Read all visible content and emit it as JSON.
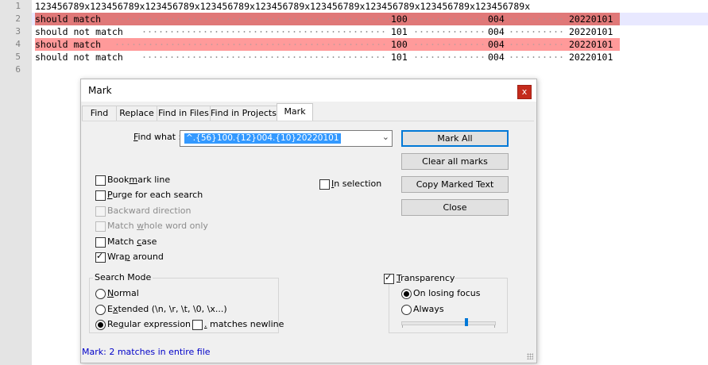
{
  "editor": {
    "lines": [
      {
        "number": "1",
        "text": "123456789x123456789x123456789x123456789x123456789x123456789x123456789x123456789x123456789x"
      },
      {
        "number": "2",
        "label": "should match",
        "col2": "100",
        "col3": "004",
        "col4": "20220101",
        "marked": true,
        "current": true
      },
      {
        "number": "3",
        "label": "should not match",
        "col2": "101",
        "col3": "004",
        "col4": "20220101",
        "marked": false
      },
      {
        "number": "4",
        "label": "should match",
        "col2": "100",
        "col3": "004",
        "col4": "20220101",
        "marked": true
      },
      {
        "number": "5",
        "label": "should not match",
        "col2": "101",
        "col3": "004",
        "col4": "20220101",
        "marked": false
      },
      {
        "number": "6",
        "text": ""
      }
    ],
    "mark_color": "#ff9a9a",
    "mark_color_current": "#e07878",
    "current_line_color": "#e8e8ff"
  },
  "dialog": {
    "title": "Mark",
    "close_glyph": "x",
    "tabs": [
      {
        "label": "Find"
      },
      {
        "label": "Replace"
      },
      {
        "label": "Find in Files"
      },
      {
        "label": "Find in Projects"
      },
      {
        "label": "Mark",
        "active": true
      }
    ],
    "find_label_pre": "",
    "find_label_ul": "F",
    "find_label_post": "ind what :",
    "find_value": "^.{56}100.{12}004.{10}20220101",
    "buttons": {
      "mark_all": "Mark All",
      "clear_all_marks": "Clear all marks",
      "copy_marked_text": "Copy Marked Text",
      "close": "Close"
    },
    "options": {
      "bookmark_line": {
        "pre": "Book",
        "ul": "m",
        "post": "ark line",
        "checked": false,
        "enabled": true
      },
      "purge_each_search": {
        "pre": "",
        "ul": "P",
        "post": "urge for each search",
        "checked": false,
        "enabled": true
      },
      "backward_direction": {
        "pre": "Backward direction",
        "ul": "",
        "post": "",
        "checked": false,
        "enabled": false
      },
      "match_whole_word": {
        "pre": "Match ",
        "ul": "w",
        "post": "hole word only",
        "checked": false,
        "enabled": false
      },
      "match_case": {
        "pre": "Match ",
        "ul": "c",
        "post": "ase",
        "checked": false,
        "enabled": true
      },
      "wrap_around": {
        "pre": "Wra",
        "ul": "p",
        "post": " around",
        "checked": true,
        "enabled": true
      },
      "in_selection": {
        "pre": "",
        "ul": "I",
        "post": "n selection",
        "checked": false,
        "enabled": true
      }
    },
    "search_mode": {
      "title": "Search Mode",
      "normal": {
        "pre": "",
        "ul": "N",
        "post": "ormal",
        "selected": false
      },
      "extended": {
        "pre": "E",
        "ul": "x",
        "post": "tended (\\n, \\r, \\t, \\0, \\x...)",
        "selected": false
      },
      "regex": {
        "pre": "Re",
        "ul": "g",
        "post": "ular expression",
        "selected": true
      },
      "matches_newline": {
        "pre": "",
        "ul": ".",
        "post": " matches newline",
        "checked": false
      }
    },
    "transparency": {
      "label_pre": "",
      "label_ul": "T",
      "label_post": "ransparency",
      "checked": true,
      "on_losing_focus": {
        "label": "On losing focus",
        "selected": true
      },
      "always": {
        "label": "Always",
        "selected": false
      },
      "slider_value": 0.7
    },
    "status": "Mark: 2 matches in entire file"
  }
}
